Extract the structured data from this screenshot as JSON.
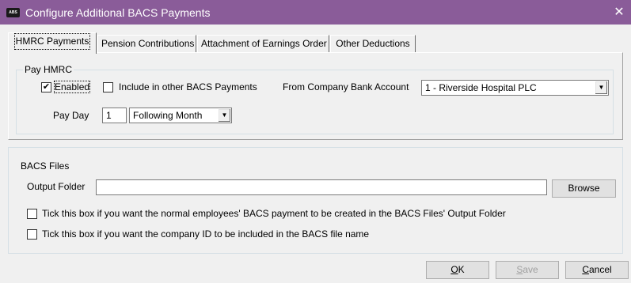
{
  "window": {
    "title": "Configure Additional BACS Payments",
    "icon_text": "ABS",
    "close_glyph": "✕"
  },
  "tabs": [
    {
      "label": "HMRC Payments",
      "active": true
    },
    {
      "label": "Pension Contributions",
      "active": false
    },
    {
      "label": "Attachment of Earnings Order",
      "active": false
    },
    {
      "label": "Other Deductions",
      "active": false
    }
  ],
  "pay_hmrc": {
    "group_label": "Pay HMRC",
    "enabled_label": "Enabled",
    "enabled_checked": true,
    "include_label": "Include in other BACS Payments",
    "include_checked": false,
    "bank_account_label": "From Company Bank Account",
    "bank_account_value": "1 - Riverside Hospital PLC",
    "pay_day_label": "Pay Day",
    "pay_day_value": "1",
    "pay_day_period": "Following Month"
  },
  "bacs_files": {
    "group_label": "BACS Files",
    "output_folder_label": "Output Folder",
    "output_folder_value": "",
    "browse_label": "Browse",
    "option1_label": "Tick this box if you want the normal employees' BACS payment to be created in the BACS Files' Output Folder",
    "option1_checked": false,
    "option2_label": "Tick this box if you want the company ID to be included in the BACS file name",
    "option2_checked": false
  },
  "buttons": {
    "ok_mnemonic": "O",
    "ok_rest": "K",
    "save_mnemonic": "S",
    "save_rest": "ave",
    "cancel_mnemonic": "C",
    "cancel_rest": "ancel"
  },
  "glyphs": {
    "check": "✔",
    "dropdown_arrow": "▼"
  },
  "colors": {
    "titlebar": "#8a5c99",
    "window_bg": "#f0f0f0"
  }
}
